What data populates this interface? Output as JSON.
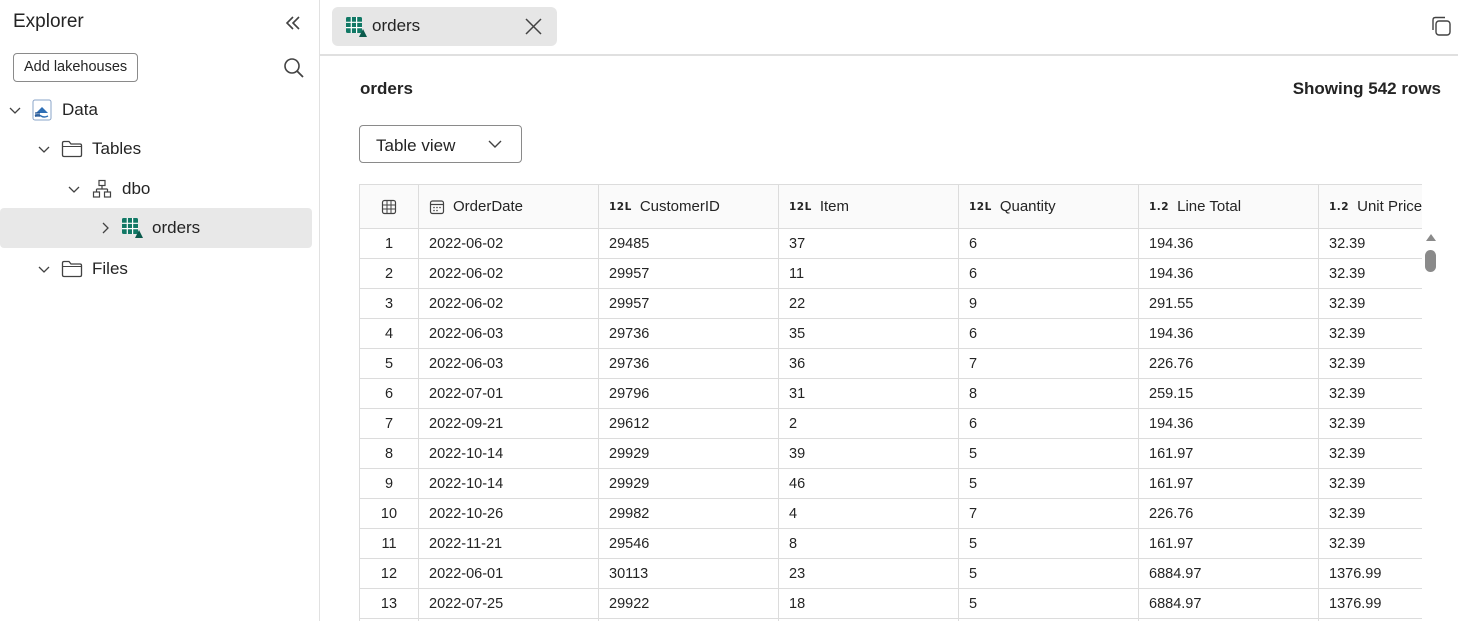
{
  "sidebar": {
    "title": "Explorer",
    "add_button": "Add lakehouses",
    "tree": {
      "data": "Data",
      "tables": "Tables",
      "dbo": "dbo",
      "orders": "orders",
      "files": "Files"
    }
  },
  "tab": {
    "label": "orders"
  },
  "main": {
    "title": "orders",
    "row_count": "Showing 542 rows",
    "view_select": "Table view"
  },
  "table": {
    "columns": [
      {
        "type_badge": "",
        "label": "OrderDate"
      },
      {
        "type_badge": "12L",
        "label": "CustomerID"
      },
      {
        "type_badge": "12L",
        "label": "Item"
      },
      {
        "type_badge": "12L",
        "label": "Quantity"
      },
      {
        "type_badge": "1.2",
        "label": "Line Total"
      },
      {
        "type_badge": "1.2",
        "label": "Unit Price"
      }
    ],
    "rows": [
      [
        "1",
        "2022-06-02",
        "29485",
        "37",
        "6",
        "194.36",
        "32.39"
      ],
      [
        "2",
        "2022-06-02",
        "29957",
        "11",
        "6",
        "194.36",
        "32.39"
      ],
      [
        "3",
        "2022-06-02",
        "29957",
        "22",
        "9",
        "291.55",
        "32.39"
      ],
      [
        "4",
        "2022-06-03",
        "29736",
        "35",
        "6",
        "194.36",
        "32.39"
      ],
      [
        "5",
        "2022-06-03",
        "29736",
        "36",
        "7",
        "226.76",
        "32.39"
      ],
      [
        "6",
        "2022-07-01",
        "29796",
        "31",
        "8",
        "259.15",
        "32.39"
      ],
      [
        "7",
        "2022-09-21",
        "29612",
        "2",
        "6",
        "194.36",
        "32.39"
      ],
      [
        "8",
        "2022-10-14",
        "29929",
        "39",
        "5",
        "161.97",
        "32.39"
      ],
      [
        "9",
        "2022-10-14",
        "29929",
        "46",
        "5",
        "161.97",
        "32.39"
      ],
      [
        "10",
        "2022-10-26",
        "29982",
        "4",
        "7",
        "226.76",
        "32.39"
      ],
      [
        "11",
        "2022-11-21",
        "29546",
        "8",
        "5",
        "161.97",
        "32.39"
      ],
      [
        "12",
        "2022-06-01",
        "30113",
        "23",
        "5",
        "6884.97",
        "1376.99"
      ],
      [
        "13",
        "2022-07-25",
        "29922",
        "18",
        "5",
        "6884.97",
        "1376.99"
      ],
      [
        "",
        "",
        "",
        "",
        "",
        "",
        ""
      ]
    ]
  },
  "icons": {
    "collapse": "double-chevron-left-icon",
    "search": "search-icon",
    "lakehouse": "lakehouse-icon",
    "folder": "folder-icon",
    "schema": "schema-icon",
    "table": "table-icon",
    "close": "close-icon",
    "copy": "copy-icon",
    "calendar": "calendar-icon",
    "grid": "grid-icon"
  },
  "colors": {
    "accent_green": "#117865",
    "selected_bg": "#e8e8e8",
    "tab_bg": "#e6e6e6",
    "lakehouse_blue": "#2f6fb5"
  }
}
